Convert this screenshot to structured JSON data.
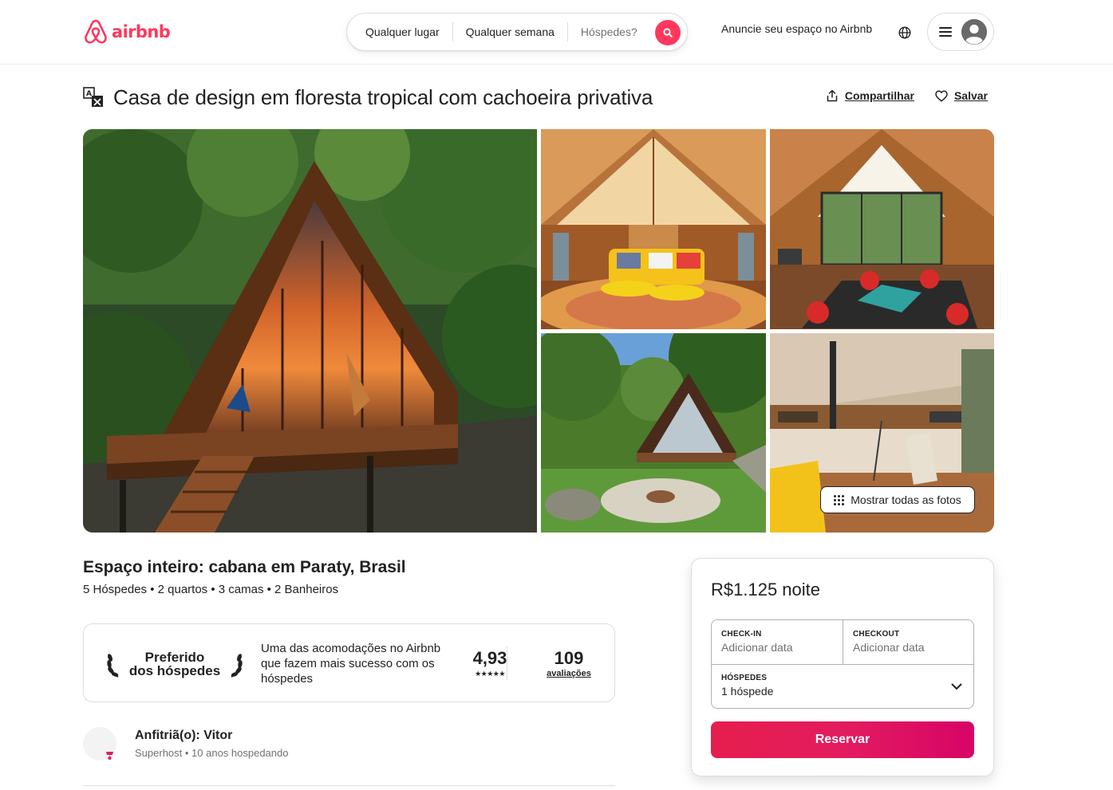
{
  "brand": {
    "name": "airbnb",
    "color": "#ff385c"
  },
  "search": {
    "where": "Qualquer lugar",
    "when": "Qualquer semana",
    "guests_placeholder": "Hóspedes?",
    "icon": "search-icon"
  },
  "header": {
    "host_link": "Anuncie seu espaço no Airbnb",
    "globe_icon": "globe-icon",
    "menu_icon": "hamburger-menu-icon",
    "avatar_icon": "user-avatar-icon"
  },
  "listing": {
    "title": "Casa de design em floresta tropical com cachoeira privativa",
    "share_label": "Compartilhar",
    "save_label": "Salvar",
    "show_all_photos": "Mostrar todas as fotos",
    "type": "Espaço inteiro: cabana em Paraty, Brasil",
    "details": "5 Hóspedes • 2 quartos • 3 camas • 2 Banheiros"
  },
  "guest_favorite": {
    "badge_line1": "Preferido",
    "badge_line2": "dos hóspedes",
    "description": "Uma das acomodações no Airbnb que fazem mais sucesso com os hóspedes",
    "rating": "4,93",
    "stars": "★★★★★",
    "reviews_count": "109",
    "reviews_label": "avaliações"
  },
  "host": {
    "name": "Anfitriã(o): Vitor",
    "subtitle": "Superhost • 10 anos hospedando"
  },
  "booking": {
    "price": "R$1.125 noite",
    "checkin_label": "CHECK-IN",
    "checkin_value": "Adicionar data",
    "checkout_label": "CHECKOUT",
    "checkout_value": "Adicionar data",
    "guests_label": "HÓSPEDES",
    "guests_value": "1 hóspede",
    "reserve_label": "Reservar",
    "button_color": "#e61e4d"
  }
}
